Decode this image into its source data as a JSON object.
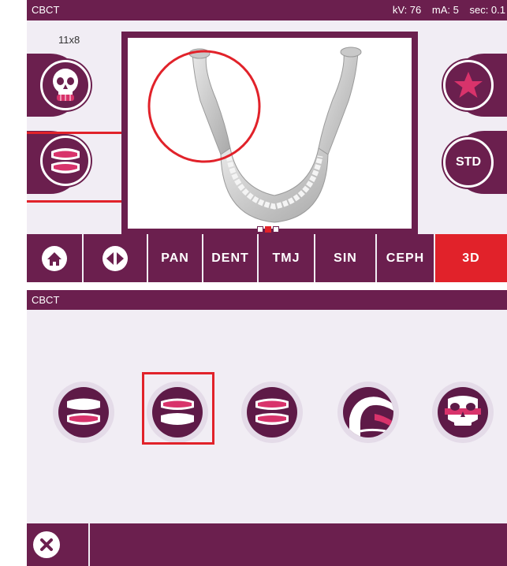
{
  "top": {
    "title": "CBCT",
    "status": {
      "kv": "kV: 76",
      "ma": "mA: 5",
      "sec": "sec: 0.1"
    },
    "size_label": "11x8",
    "std_label": "STD",
    "page_indicator": {
      "count": 3,
      "active": 2
    },
    "tabs": [
      "PAN",
      "DENT",
      "TMJ",
      "SIN",
      "CEPH",
      "3D"
    ],
    "active_tab": "3D"
  },
  "bottom": {
    "title": "CBCT",
    "exam_icons": [
      "full-dentition-icon",
      "lower-jaw-icon",
      "upper-jaw-icon",
      "tmj-icon",
      "sinus-icon"
    ],
    "selected": "lower-jaw-icon"
  },
  "colors": {
    "primary": "#6b1f4e",
    "accent": "#e1222a",
    "background": "#f1edf4",
    "tooth_pink": "#d8336b"
  }
}
